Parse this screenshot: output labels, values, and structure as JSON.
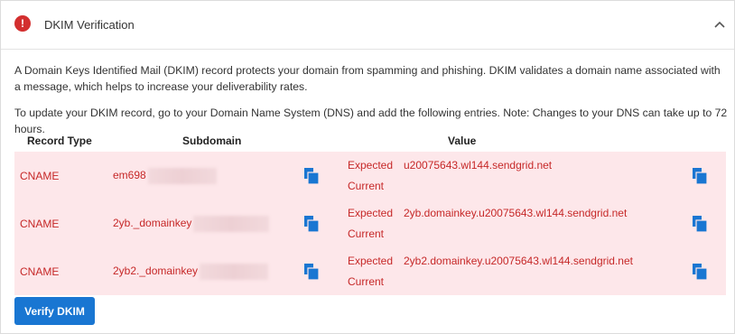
{
  "panel": {
    "title": "DKIM Verification",
    "alert_icon": "!",
    "description1": "A Domain Keys Identified Mail (DKIM) record protects your domain from spamming and phishing. DKIM validates a domain name associated with a message, which helps to increase your deliverability rates.",
    "description2": "To update your DKIM record, go to your Domain Name System (DNS) and add the following entries. Note: Changes to your DNS can take up to 72 hours."
  },
  "table": {
    "headers": {
      "record_type": "Record Type",
      "subdomain": "Subdomain",
      "value": "Value"
    },
    "rows": [
      {
        "type": "CNAME",
        "subdomain": "em698",
        "expected_label": "Expected",
        "current_label": "Current",
        "expected": "u20075643.wl144.sendgrid.net",
        "current": ""
      },
      {
        "type": "CNAME",
        "subdomain": "2yb._domainkey",
        "expected_label": "Expected",
        "current_label": "Current",
        "expected": "2yb.domainkey.u20075643.wl144.sendgrid.net",
        "current": ""
      },
      {
        "type": "CNAME",
        "subdomain": "2yb2._domainkey",
        "expected_label": "Expected",
        "current_label": "Current",
        "expected": "2yb2.domainkey.u20075643.wl144.sendgrid.net",
        "current": ""
      }
    ]
  },
  "verify_button": "Verify DKIM",
  "colors": {
    "error_red": "#c62828",
    "row_bg": "#fde7ea",
    "primary_blue": "#1976d2",
    "alert_red": "#d32f2f"
  },
  "icons": [
    "alert-icon",
    "chevron-up-icon",
    "copy-icon"
  ]
}
